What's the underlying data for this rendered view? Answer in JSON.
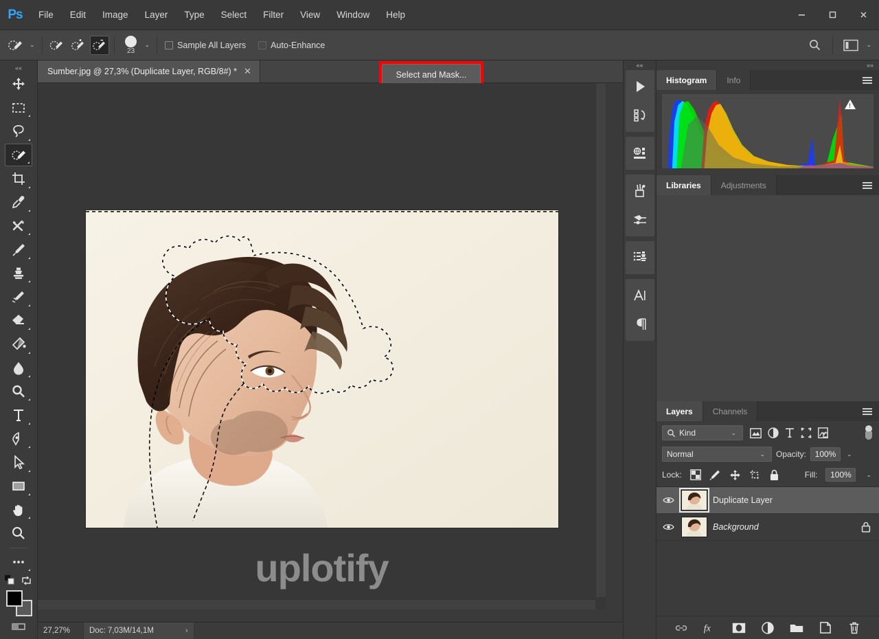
{
  "app": {
    "name": "Adobe Photoshop",
    "logo_text": "Ps"
  },
  "menubar": {
    "items": [
      {
        "label": "File"
      },
      {
        "label": "Edit"
      },
      {
        "label": "Image"
      },
      {
        "label": "Layer"
      },
      {
        "label": "Type"
      },
      {
        "label": "Select"
      },
      {
        "label": "Filter"
      },
      {
        "label": "View"
      },
      {
        "label": "Window"
      },
      {
        "label": "Help"
      }
    ],
    "window_controls": {
      "minimize": "—",
      "maximize": "☐",
      "close": "✕"
    }
  },
  "options_bar": {
    "tool": "Quick Selection Tool",
    "selection_modes": [
      {
        "name": "new-selection",
        "active": false
      },
      {
        "name": "add-to-selection",
        "active": false
      },
      {
        "name": "subtract-from-selection",
        "active": true
      }
    ],
    "brush_size": "23",
    "checkboxes": [
      {
        "label": "Sample All Layers",
        "checked": false
      },
      {
        "label": "Auto-Enhance",
        "checked": false
      }
    ],
    "select_and_mask_label": "Select and Mask...",
    "highlight_color": "#ff0000",
    "search_icon": "search-icon",
    "workspace_icon": "workspace-icon",
    "chevron": "⌄"
  },
  "toolbar": {
    "collapse": "««",
    "tools": [
      {
        "name": "move-tool",
        "label": "Move Tool",
        "active": false
      },
      {
        "name": "marquee-tool",
        "label": "Rectangular Marquee Tool",
        "active": false
      },
      {
        "name": "lasso-tool",
        "label": "Lasso Tool",
        "active": false
      },
      {
        "name": "quick-selection-tool",
        "label": "Quick Selection Tool",
        "active": true
      },
      {
        "name": "crop-tool",
        "label": "Crop Tool",
        "active": false
      },
      {
        "name": "eyedropper-tool",
        "label": "Eyedropper Tool",
        "active": false
      },
      {
        "name": "healing-brush-tool",
        "label": "Spot Healing Brush Tool",
        "active": false
      },
      {
        "name": "brush-tool",
        "label": "Brush Tool",
        "active": false
      },
      {
        "name": "clone-stamp-tool",
        "label": "Clone Stamp Tool",
        "active": false
      },
      {
        "name": "history-brush-tool",
        "label": "History Brush Tool",
        "active": false
      },
      {
        "name": "eraser-tool",
        "label": "Eraser Tool",
        "active": false
      },
      {
        "name": "gradient-tool",
        "label": "Gradient Tool",
        "active": false
      },
      {
        "name": "blur-tool",
        "label": "Blur Tool",
        "active": false
      },
      {
        "name": "dodge-tool",
        "label": "Dodge Tool",
        "active": false
      },
      {
        "name": "type-tool",
        "label": "Horizontal Type Tool",
        "active": false
      },
      {
        "name": "pen-tool",
        "label": "Pen Tool",
        "active": false
      },
      {
        "name": "path-selection-tool",
        "label": "Path Selection Tool",
        "active": false
      },
      {
        "name": "shape-tool",
        "label": "Rectangle Tool",
        "active": false
      },
      {
        "name": "hand-tool",
        "label": "Hand Tool",
        "active": false
      },
      {
        "name": "zoom-tool",
        "label": "Zoom Tool",
        "active": false
      },
      {
        "name": "edit-toolbar",
        "label": "Edit Toolbar",
        "active": false
      }
    ],
    "foreground_color": "#000000",
    "background_color": "#ffffff"
  },
  "document": {
    "tab_title": "Sumber.jpg @ 27,3% (Duplicate Layer, RGB/8#) *",
    "tab_close": "✕",
    "canvas_bg": "#f5f0e4"
  },
  "watermark": {
    "text": "uplotify"
  },
  "status_bar": {
    "zoom": "27,27%",
    "doc_info": "Doc: 7,03M/14,1M",
    "arrow": "›"
  },
  "icon_dock": {
    "collapse": "««",
    "groups": [
      {
        "items": [
          {
            "name": "actions-icon"
          },
          {
            "name": "history-icon"
          }
        ]
      },
      {
        "items": [
          {
            "name": "3d-icon"
          }
        ]
      },
      {
        "items": [
          {
            "name": "brushes-icon"
          },
          {
            "name": "brush-settings-icon"
          }
        ]
      },
      {
        "items": [
          {
            "name": "clone-source-icon"
          }
        ]
      },
      {
        "items": [
          {
            "name": "character-icon"
          },
          {
            "name": "paragraph-icon"
          }
        ]
      }
    ]
  },
  "right_panel": {
    "collapse": "»»",
    "histogram_panel": {
      "tabs": [
        {
          "label": "Histogram",
          "active": true
        },
        {
          "label": "Info",
          "active": false
        }
      ],
      "menu_icon": "panel-menu-icon",
      "warning_icon": "cached-data-warning-icon"
    },
    "libraries_panel": {
      "tabs": [
        {
          "label": "Libraries",
          "active": true
        },
        {
          "label": "Adjustments",
          "active": false
        }
      ],
      "menu_icon": "panel-menu-icon"
    },
    "layers_panel": {
      "tabs": [
        {
          "label": "Layers",
          "active": true
        },
        {
          "label": "Channels",
          "active": false
        }
      ],
      "menu_icon": "panel-menu-icon",
      "filter_kind_label": "Kind",
      "filter_icons": [
        {
          "name": "filter-pixel-icon"
        },
        {
          "name": "filter-adjustment-icon"
        },
        {
          "name": "filter-type-icon"
        },
        {
          "name": "filter-shape-icon"
        },
        {
          "name": "filter-smartobject-icon"
        }
      ],
      "blend_mode": "Normal",
      "opacity_label": "Opacity:",
      "opacity_value": "100%",
      "lock_label": "Lock:",
      "lock_icons": [
        {
          "name": "lock-transparent-pixels-icon"
        },
        {
          "name": "lock-image-pixels-icon"
        },
        {
          "name": "lock-position-icon"
        },
        {
          "name": "lock-artboard-icon"
        },
        {
          "name": "lock-all-icon"
        }
      ],
      "fill_label": "Fill:",
      "fill_value": "100%",
      "layers": [
        {
          "name": "Duplicate Layer",
          "visible": true,
          "selected": true,
          "locked": false,
          "italic": false
        },
        {
          "name": "Background",
          "visible": true,
          "selected": false,
          "locked": true,
          "italic": true
        }
      ],
      "footer_buttons": [
        {
          "name": "link-layers-icon"
        },
        {
          "name": "layer-style-fx-icon"
        },
        {
          "name": "add-layer-mask-icon"
        },
        {
          "name": "new-adjustment-layer-icon"
        },
        {
          "name": "new-group-icon"
        },
        {
          "name": "new-layer-icon"
        },
        {
          "name": "delete-layer-icon"
        }
      ]
    }
  }
}
